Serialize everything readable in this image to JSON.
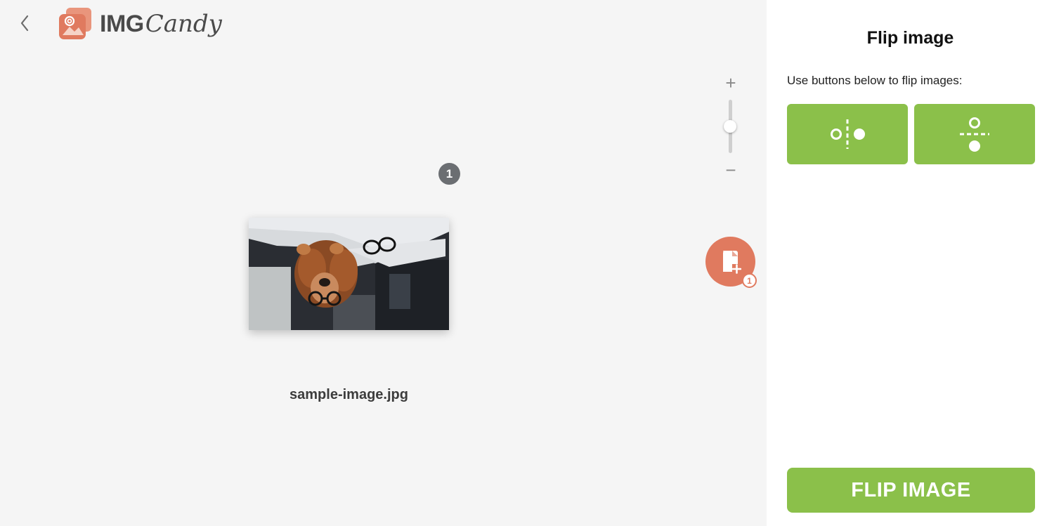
{
  "header": {
    "back_icon": "chevron-left-icon",
    "logo_text_img": "IMG",
    "logo_text_candy": "Candy",
    "logo_icon": "candy-image-logo-icon",
    "brand_color": "#e07a5f"
  },
  "zoom": {
    "plus_label": "+",
    "minus_label": "−",
    "level": 0.55
  },
  "file": {
    "index": "1",
    "name": "sample-image.jpg",
    "thumbnail_icon": "dog-photo-thumbnail"
  },
  "add_file": {
    "icon": "file-plus-icon",
    "count": "1"
  },
  "sidebar": {
    "title": "Flip image",
    "description": "Use buttons below to flip images:",
    "flip_horizontal_icon": "flip-horizontal-icon",
    "flip_vertical_icon": "flip-vertical-icon",
    "submit_label": "FLIP IMAGE",
    "accent_color": "#8bc04a"
  }
}
